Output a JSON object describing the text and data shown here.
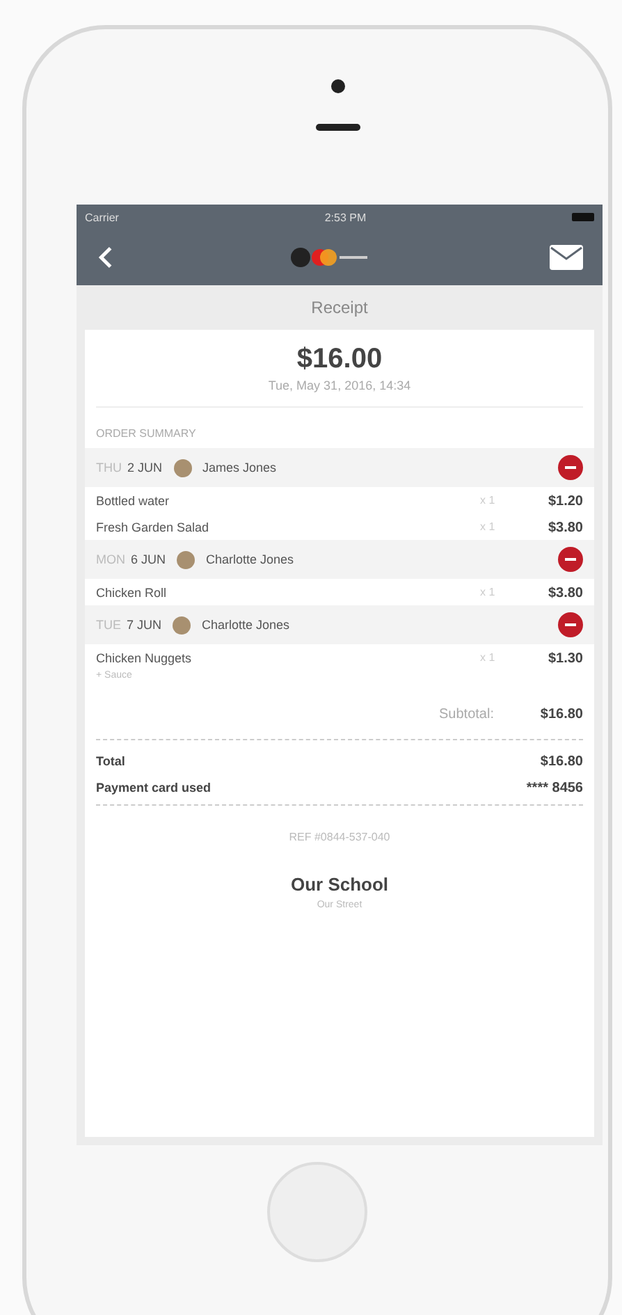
{
  "status_bar": {
    "carrier": "Carrier",
    "time": "2:53 PM"
  },
  "nav": {
    "title": "Receipt"
  },
  "receipt": {
    "amount": "$16.00",
    "date": "Tue, May 31, 2016, 14:34"
  },
  "order_summary": {
    "heading": "ORDER SUMMARY",
    "groups": [
      {
        "day": "THU",
        "date": "2 JUN",
        "name": "James Jones",
        "items": [
          {
            "name": "Bottled water",
            "qty": "x 1",
            "price": "$1.20"
          },
          {
            "name": "Fresh Garden Salad",
            "qty": "x 1",
            "price": "$3.80"
          }
        ]
      },
      {
        "day": "MON",
        "date": "6 JUN",
        "name": "Charlotte Jones",
        "items": [
          {
            "name": "Chicken Roll",
            "qty": "x 1",
            "price": "$3.80"
          }
        ]
      },
      {
        "day": "TUE",
        "date": "7 JUN",
        "name": "Charlotte Jones",
        "items": [
          {
            "name": "Chicken Nuggets",
            "qty": "x 1",
            "price": "$1.30",
            "note": "+ Sauce"
          }
        ]
      }
    ],
    "subtotal_label": "Subtotal:",
    "subtotal": "$16.80"
  },
  "totals": [
    {
      "label": "Total",
      "value": "$16.80"
    },
    {
      "label": "Payment card used",
      "value": "**** 8456"
    }
  ],
  "reference": "REF #0844-537-040",
  "school": {
    "name": "Our School",
    "address": "Our Street"
  }
}
